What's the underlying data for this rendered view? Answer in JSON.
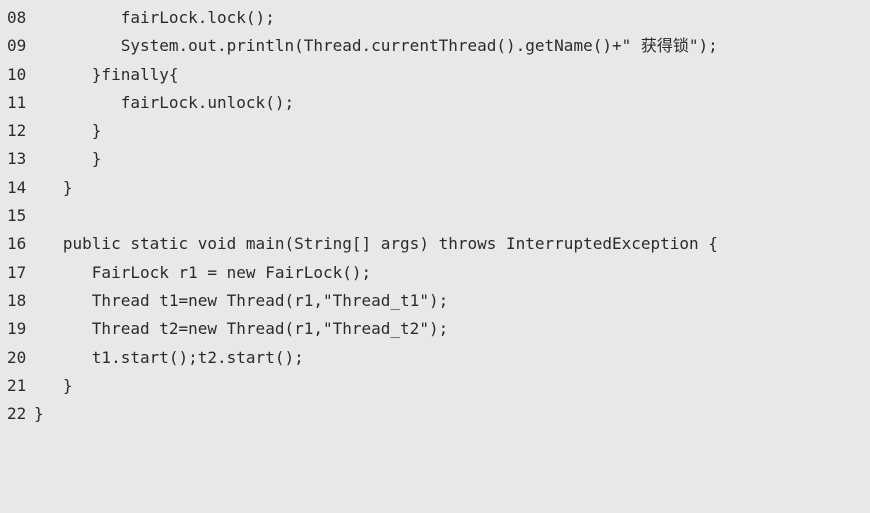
{
  "code": {
    "lines": [
      {
        "number": "08",
        "text": "         fairLock.lock();"
      },
      {
        "number": "09",
        "text": "         System.out.println(Thread.currentThread().getName()+\" 获得锁\");"
      },
      {
        "number": "10",
        "text": "      }finally{"
      },
      {
        "number": "11",
        "text": "         fairLock.unlock();"
      },
      {
        "number": "12",
        "text": "      }"
      },
      {
        "number": "13",
        "text": "      }"
      },
      {
        "number": "14",
        "text": "   }"
      },
      {
        "number": "15",
        "text": ""
      },
      {
        "number": "16",
        "text": "   public static void main(String[] args) throws InterruptedException {"
      },
      {
        "number": "17",
        "text": "      FairLock r1 = new FairLock();"
      },
      {
        "number": "18",
        "text": "      Thread t1=new Thread(r1,\"Thread_t1\");"
      },
      {
        "number": "19",
        "text": "      Thread t2=new Thread(r1,\"Thread_t2\");"
      },
      {
        "number": "20",
        "text": "      t1.start();t2.start();"
      },
      {
        "number": "21",
        "text": "   }"
      },
      {
        "number": "22",
        "text": "}"
      }
    ]
  }
}
